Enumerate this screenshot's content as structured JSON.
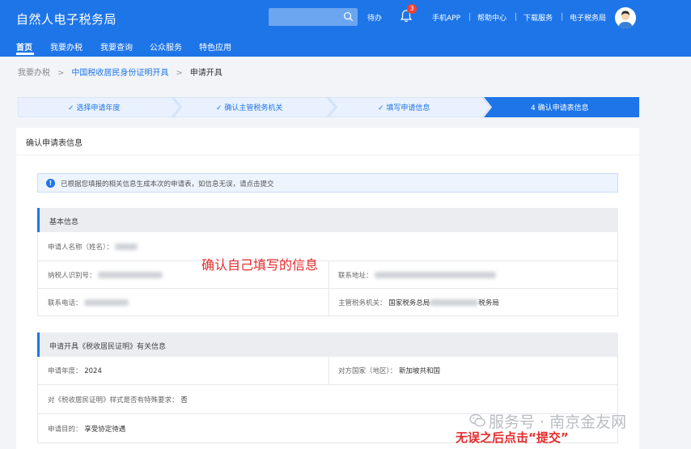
{
  "header": {
    "app_title": "自然人电子税务局",
    "search": {
      "value": "",
      "placeholder": ""
    },
    "todo_label": "待办",
    "notification_count": "3",
    "links": [
      "手机APP",
      "帮助中心",
      "下载服务",
      "电子税务局"
    ]
  },
  "nav": {
    "items": [
      "首页",
      "我要办税",
      "我要查询",
      "公众服务",
      "特色应用"
    ],
    "active_index": 0
  },
  "breadcrumb": {
    "items": [
      "我要办税",
      "中国税收居民身份证明开具",
      "申请开具"
    ]
  },
  "steps": [
    {
      "label": "✓ 选择申请年度"
    },
    {
      "label": "✓ 确认主管税务机关"
    },
    {
      "label": "✓ 填写申请信息"
    },
    {
      "label": "4   确认申请表信息"
    }
  ],
  "card": {
    "title": "确认申请表信息",
    "notice": "已根据您填报的相关信息生成本次的申请表，如信息无误，请点击提交"
  },
  "basic_info": {
    "title": "基本信息",
    "applicant_label": "申请人名称（姓名）：",
    "taxpayer_id_label": "纳税人识别号：",
    "contact_address_label": "联系地址：",
    "contact_phone_label": "联系电话：",
    "tax_authority_label": "主管税务机关：",
    "tax_authority_prefix": "国家税务总局",
    "tax_authority_suffix": "税务局"
  },
  "cert_info": {
    "title": "申请开具《税收居民证明》有关信息",
    "year_label": "申请年度：",
    "year_value": "2024",
    "country_label": "对方国家（地区）：",
    "country_value": "新加坡共和国",
    "special_format_label": "对《税收居民证明》样式是否有特殊要求：",
    "special_format_value": "否",
    "purpose_label": "申请目的：",
    "purpose_value": "享受协定待遇"
  },
  "annotations": {
    "confirm_info": "确认自己填写的信息",
    "submit_hint": "无误之后点击“提交”",
    "watermark": "服务号 · 南京金友网"
  },
  "colors": {
    "primary": "#1e75e8",
    "step_done_bg": "#e8f1fd",
    "annotation_red": "#e52b2b"
  }
}
